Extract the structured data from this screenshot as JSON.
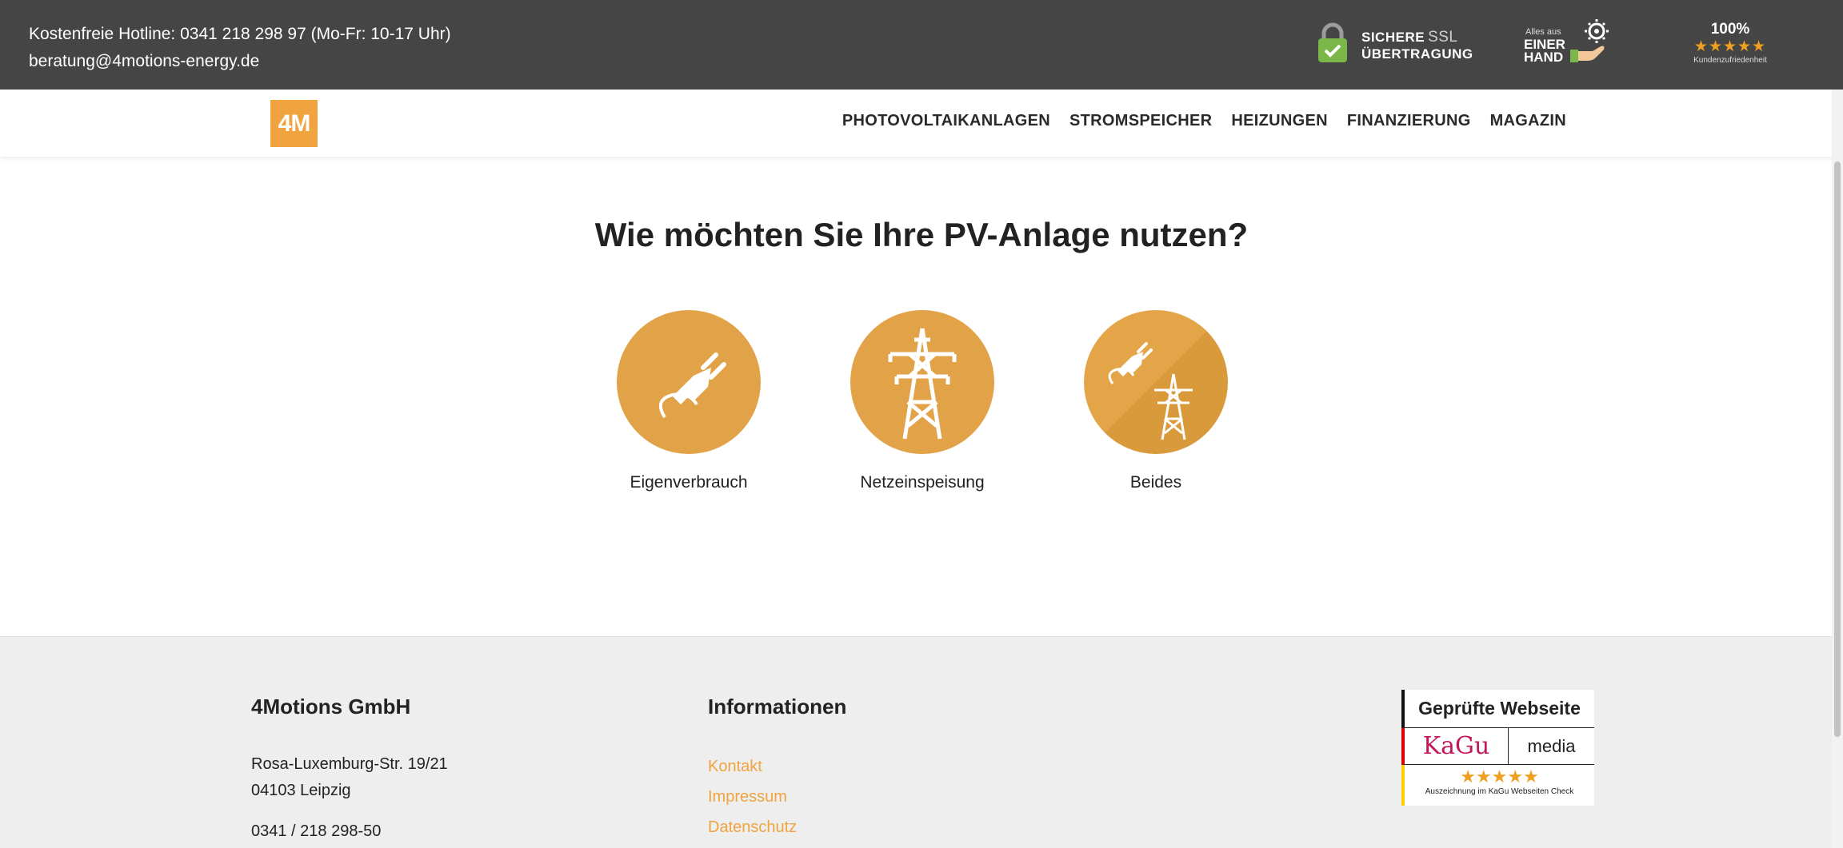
{
  "topbar": {
    "hotline": "Kostenfreie Hotline: 0341 218 298 97 (Mo-Fr: 10-17 Uhr)",
    "email": "beratung@4motions-energy.de",
    "ssl": {
      "line1": "SICHERE",
      "line1b": "SSL",
      "line2": "ÜBERTRAGUNG"
    },
    "hand": {
      "small": "Alles aus",
      "line1": "EINER",
      "line2": "HAND"
    },
    "rating": {
      "pct": "100%",
      "stars": "★★★★★",
      "sub": "Kundenzufriedenheit"
    }
  },
  "nav": {
    "logo": "4M",
    "items": [
      "PHOTOVOLTAIKANLAGEN",
      "STROMSPEICHER",
      "HEIZUNGEN",
      "FINANZIERUNG",
      "MAGAZIN"
    ]
  },
  "main": {
    "question": "Wie möchten Sie Ihre PV-Anlage nutzen?",
    "options": [
      {
        "label": "Eigenverbrauch",
        "icon": "plug-icon"
      },
      {
        "label": "Netzeinspeisung",
        "icon": "power-tower-icon"
      },
      {
        "label": "Beides",
        "icon": "plug-and-tower-icon"
      }
    ]
  },
  "footer": {
    "company": {
      "title": "4Motions GmbH",
      "street": "Rosa-Luxemburg-Str. 19/21",
      "city": "04103 Leipzig",
      "phone": "0341 / 218 298-50"
    },
    "info": {
      "title": "Informationen",
      "links": [
        "Kontakt",
        "Impressum",
        "Datenschutz"
      ]
    },
    "badge": {
      "title": "Geprüfte Webseite",
      "brand": "KaGu",
      "brand2": "media",
      "stars": "★★★★★",
      "caption": "Auszeichnung im KaGu Webseiten Check"
    }
  },
  "colors": {
    "accent": "#f0a33e",
    "circle": "#e2a247",
    "topbar": "#454545"
  }
}
